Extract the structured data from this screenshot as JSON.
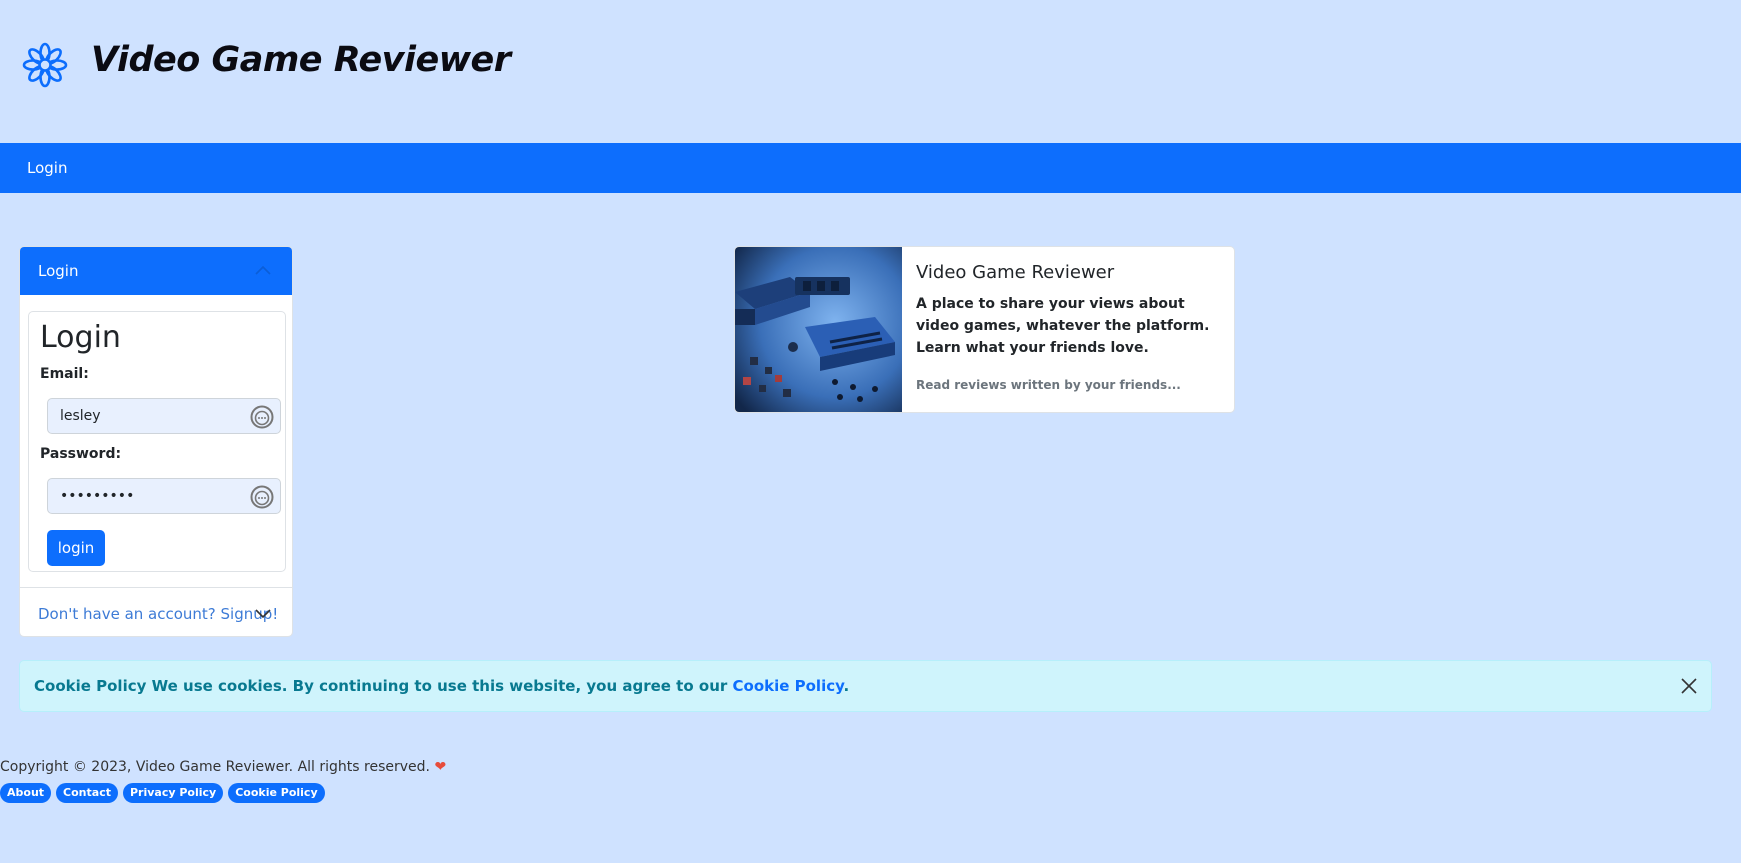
{
  "header": {
    "title": "Video Game Reviewer"
  },
  "nav": {
    "items": [
      {
        "label": "Login"
      }
    ]
  },
  "login_panel": {
    "header_label": "Login",
    "title": "Login",
    "email_label": "Email:",
    "email_value": "lesley",
    "password_label": "Password:",
    "password_value": "•••••••••",
    "button_label": "login",
    "signup_label": "Don't have an account? Signup!"
  },
  "feature": {
    "title": "Video Game Reviewer",
    "text": "A place to share your views about video games, whatever the platform. Learn what your friends love.",
    "muted": "Read reviews written by your friends..."
  },
  "cookie": {
    "strong": "Cookie Policy",
    "text": "We use cookies. By continuing to use this website, you agree to our",
    "link": "Cookie Policy",
    "end": "."
  },
  "footer": {
    "copyright": "Copyright © 2023, Video Game Reviewer. All rights reserved.",
    "heart": "❤",
    "links": [
      "About",
      "Contact",
      "Privacy Policy",
      "Cookie Policy"
    ]
  },
  "colors": {
    "page_bg": "#cfe2ff",
    "primary": "#0d6efd",
    "alert_bg": "#cff4fc",
    "alert_text": "#087990"
  },
  "icons": [
    "flower-logo-icon",
    "chevron-up-icon",
    "password-manager-icon",
    "chevron-down-icon",
    "close-icon",
    "heart-icon"
  ]
}
